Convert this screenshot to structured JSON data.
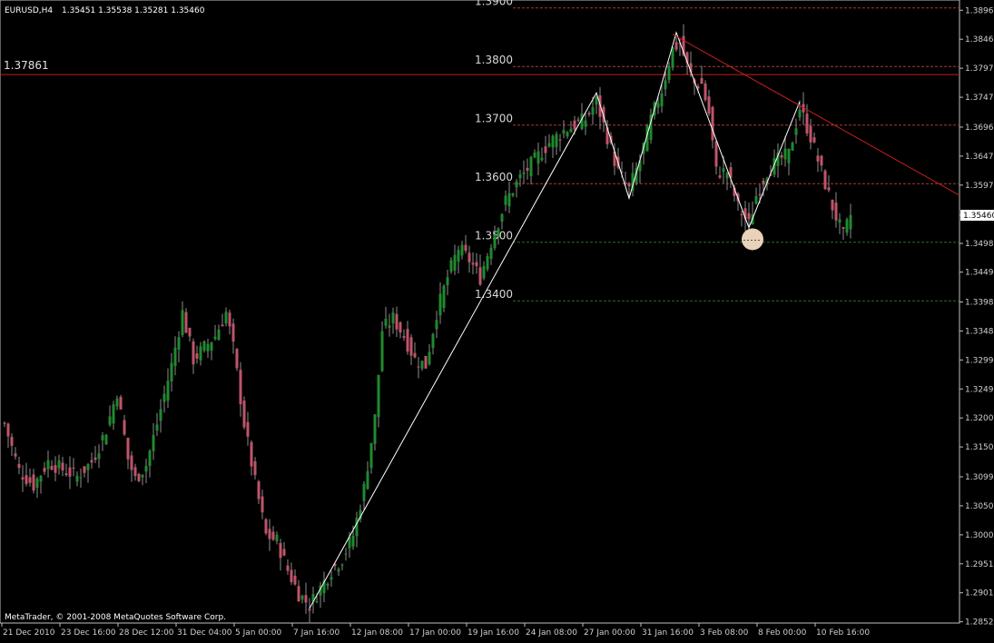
{
  "header": {
    "symbol": "EURUSD,H4",
    "quotes": "1.35451 1.35538 1.35281 1.35460"
  },
  "footer": {
    "copyright": "MetaTrader, © 2001-2008 MetaQuotes Software Corp."
  },
  "colors": {
    "background": "#000000",
    "axis": "#bfbfbf",
    "bull": "#1f8a2e",
    "bear": "#c0546a",
    "trendline": "#c81e1e",
    "zigzag": "#ffffff",
    "marker": "#f6dcc4",
    "current_price_box": "#ffffff"
  },
  "chart_data": {
    "type": "candlestick",
    "symbol": "EURUSD",
    "timeframe": "H4",
    "ylim": [
      1.2853,
      1.3898
    ],
    "y_ticks": [
      1.3896,
      1.38465,
      1.3797,
      1.37475,
      1.36965,
      1.3647,
      1.35975,
      1.3546,
      1.3498,
      1.3449,
      1.3398,
      1.33485,
      1.3299,
      1.32495,
      1.32,
      1.31505,
      1.30995,
      1.305,
      1.30005,
      1.2951,
      1.29015,
      1.2852
    ],
    "y_tick_labels": [
      "1.38960",
      "1.38465",
      "1.37970",
      "1.37475",
      "1.36965",
      "1.36470",
      "1.35975",
      "1.35460",
      "1.34980",
      "1.34490",
      "1.33980",
      "1.33485",
      "1.32990",
      "1.32495",
      "1.32000",
      "1.31505",
      "1.30995",
      "1.30500",
      "1.30005",
      "1.29510",
      "1.29015",
      "1.28520"
    ],
    "current_price": 1.3546,
    "current_price_label": "1.35460",
    "x_labels": [
      "21 Dec 2010",
      "23 Dec 16:00",
      "28 Dec 12:00",
      "31 Dec 04:00",
      "5 Jan 00:00",
      "7 Jan 16:00",
      "12 Jan 08:00",
      "17 Jan 00:00",
      "19 Jan 16:00",
      "24 Jan 08:00",
      "27 Jan 00:00",
      "31 Jan 16:00",
      "3 Feb 08:00",
      "8 Feb 00:00",
      "10 Feb 16:00"
    ],
    "x_label_index": [
      0,
      16,
      32,
      48,
      64,
      80,
      96,
      112,
      128,
      144,
      160,
      176,
      192,
      208,
      224
    ],
    "horizontal_line": {
      "price": 1.37861,
      "label": "1.37861"
    },
    "levels": [
      {
        "price": 1.39,
        "label": "1.3900"
      },
      {
        "price": 1.38,
        "label": "1.3800"
      },
      {
        "price": 1.37,
        "label": "1.3700"
      },
      {
        "price": 1.36,
        "label": "1.3600"
      },
      {
        "price": 1.35,
        "label": "1.3500"
      },
      {
        "price": 1.34,
        "label": "1.3400"
      }
    ],
    "trendline": [
      {
        "index": 184,
        "price": 1.3855
      },
      {
        "index": 263,
        "price": 1.358
      }
    ],
    "zigzag": [
      {
        "index": 84,
        "price": 1.2875
      },
      {
        "index": 163,
        "price": 1.3755
      },
      {
        "index": 172,
        "price": 1.3575
      },
      {
        "index": 185,
        "price": 1.3858
      },
      {
        "index": 205,
        "price": 1.3525
      },
      {
        "index": 219,
        "price": 1.374
      }
    ],
    "marker": {
      "index": 206,
      "price": 1.3505
    },
    "close_path": [
      [
        0,
        1.319
      ],
      [
        4,
        1.311
      ],
      [
        8,
        1.3085
      ],
      [
        12,
        1.3125
      ],
      [
        16,
        1.3112
      ],
      [
        20,
        1.31
      ],
      [
        24,
        1.3125
      ],
      [
        28,
        1.318
      ],
      [
        31,
        1.3245
      ],
      [
        34,
        1.313
      ],
      [
        36,
        1.3095
      ],
      [
        39,
        1.312
      ],
      [
        42,
        1.319
      ],
      [
        46,
        1.329
      ],
      [
        49,
        1.338
      ],
      [
        52,
        1.33
      ],
      [
        55,
        1.332
      ],
      [
        58,
        1.334
      ],
      [
        61,
        1.338
      ],
      [
        63,
        1.332
      ],
      [
        66,
        1.319
      ],
      [
        69,
        1.309
      ],
      [
        72,
        1.3
      ],
      [
        75,
        1.299
      ],
      [
        78,
        1.294
      ],
      [
        81,
        1.29
      ],
      [
        84,
        1.288
      ],
      [
        87,
        1.291
      ],
      [
        90,
        1.294
      ],
      [
        93,
        1.296
      ],
      [
        96,
        1.3
      ],
      [
        99,
        1.308
      ],
      [
        102,
        1.32
      ],
      [
        104,
        1.335
      ],
      [
        107,
        1.337
      ],
      [
        110,
        1.334
      ],
      [
        113,
        1.33
      ],
      [
        116,
        1.329
      ],
      [
        119,
        1.338
      ],
      [
        122,
        1.344
      ],
      [
        125,
        1.349
      ],
      [
        128,
        1.347
      ],
      [
        131,
        1.344
      ],
      [
        134,
        1.35
      ],
      [
        138,
        1.357
      ],
      [
        142,
        1.361
      ],
      [
        146,
        1.364
      ],
      [
        150,
        1.367
      ],
      [
        154,
        1.369
      ],
      [
        157,
        1.37
      ],
      [
        160,
        1.371
      ],
      [
        163,
        1.374
      ],
      [
        166,
        1.368
      ],
      [
        169,
        1.362
      ],
      [
        172,
        1.359
      ],
      [
        175,
        1.364
      ],
      [
        178,
        1.371
      ],
      [
        181,
        1.376
      ],
      [
        184,
        1.383
      ],
      [
        186,
        1.384
      ],
      [
        188,
        1.38
      ],
      [
        190,
        1.377
      ],
      [
        192,
        1.377
      ],
      [
        194,
        1.372
      ],
      [
        196,
        1.362
      ],
      [
        199,
        1.362
      ],
      [
        202,
        1.356
      ],
      [
        205,
        1.353
      ],
      [
        207,
        1.358
      ],
      [
        210,
        1.362
      ],
      [
        213,
        1.364
      ],
      [
        216,
        1.365
      ],
      [
        219,
        1.373
      ],
      [
        222,
        1.368
      ],
      [
        225,
        1.362
      ],
      [
        228,
        1.356
      ],
      [
        231,
        1.351
      ],
      [
        233,
        1.3546
      ]
    ]
  }
}
